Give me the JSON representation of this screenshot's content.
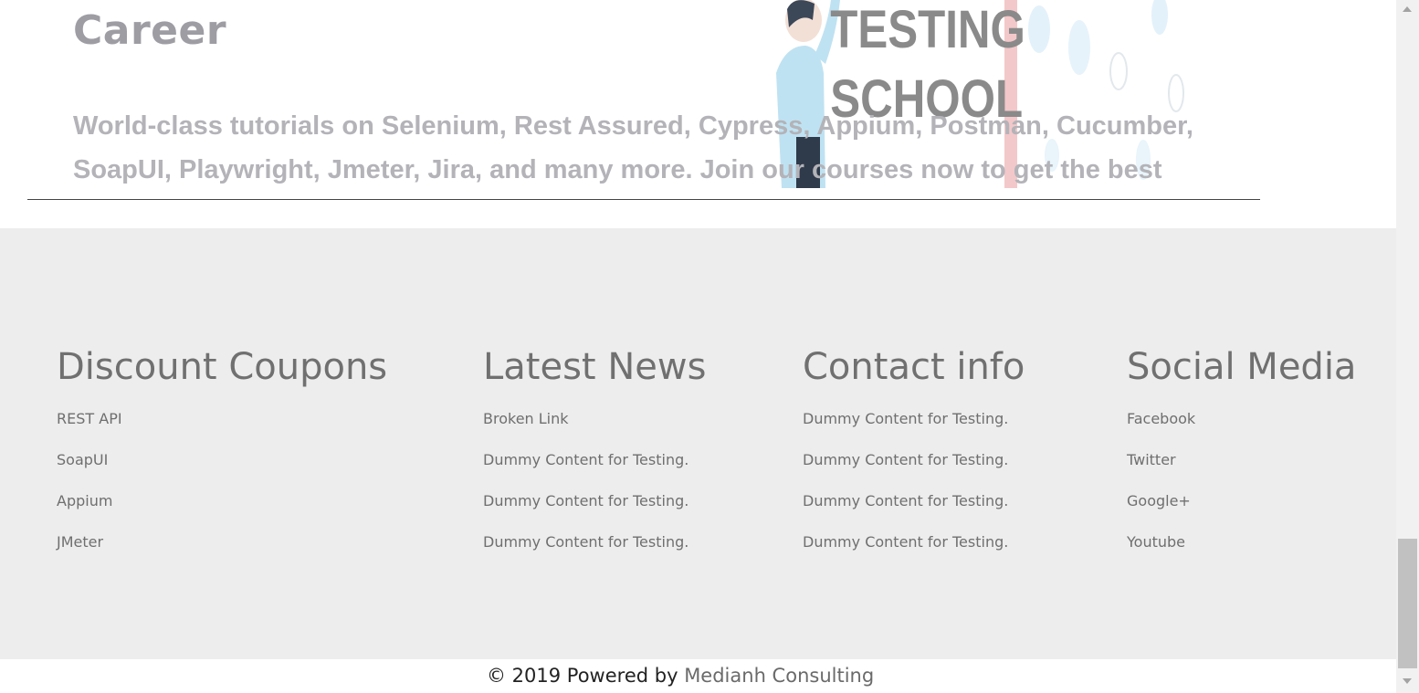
{
  "embed": {
    "heading": "Career",
    "body_text": "World-class tutorials on Selenium, Rest Assured, Cypress, Appium, Postman, Cucumber, SoapUI, Playwright, Jmeter, Jira, and many more. Join our courses now to get the best job",
    "illustration_line1": "TESTING",
    "illustration_line2": "SCHOOL"
  },
  "footer": {
    "columns": [
      {
        "title": "Discount Coupons",
        "links": [
          "REST API",
          "SoapUI",
          "Appium",
          "JMeter"
        ]
      },
      {
        "title": "Latest News",
        "links": [
          "Broken Link",
          "Dummy Content for Testing.",
          "Dummy Content for Testing.",
          "Dummy Content for Testing."
        ]
      },
      {
        "title": "Contact info",
        "links": [
          "Dummy Content for Testing.",
          "Dummy Content for Testing.",
          "Dummy Content for Testing.",
          "Dummy Content for Testing."
        ]
      },
      {
        "title": "Social Media",
        "links": [
          "Facebook",
          "Twitter",
          "Google+",
          "Youtube"
        ]
      }
    ],
    "copyright_prefix": "© 2019 Powered by ",
    "copyright_link": "Medianh Consulting"
  },
  "colors": {
    "footer_bg": "#ededed",
    "heading_faded": "#9d9da3",
    "footer_text": "#6f6f6f"
  }
}
